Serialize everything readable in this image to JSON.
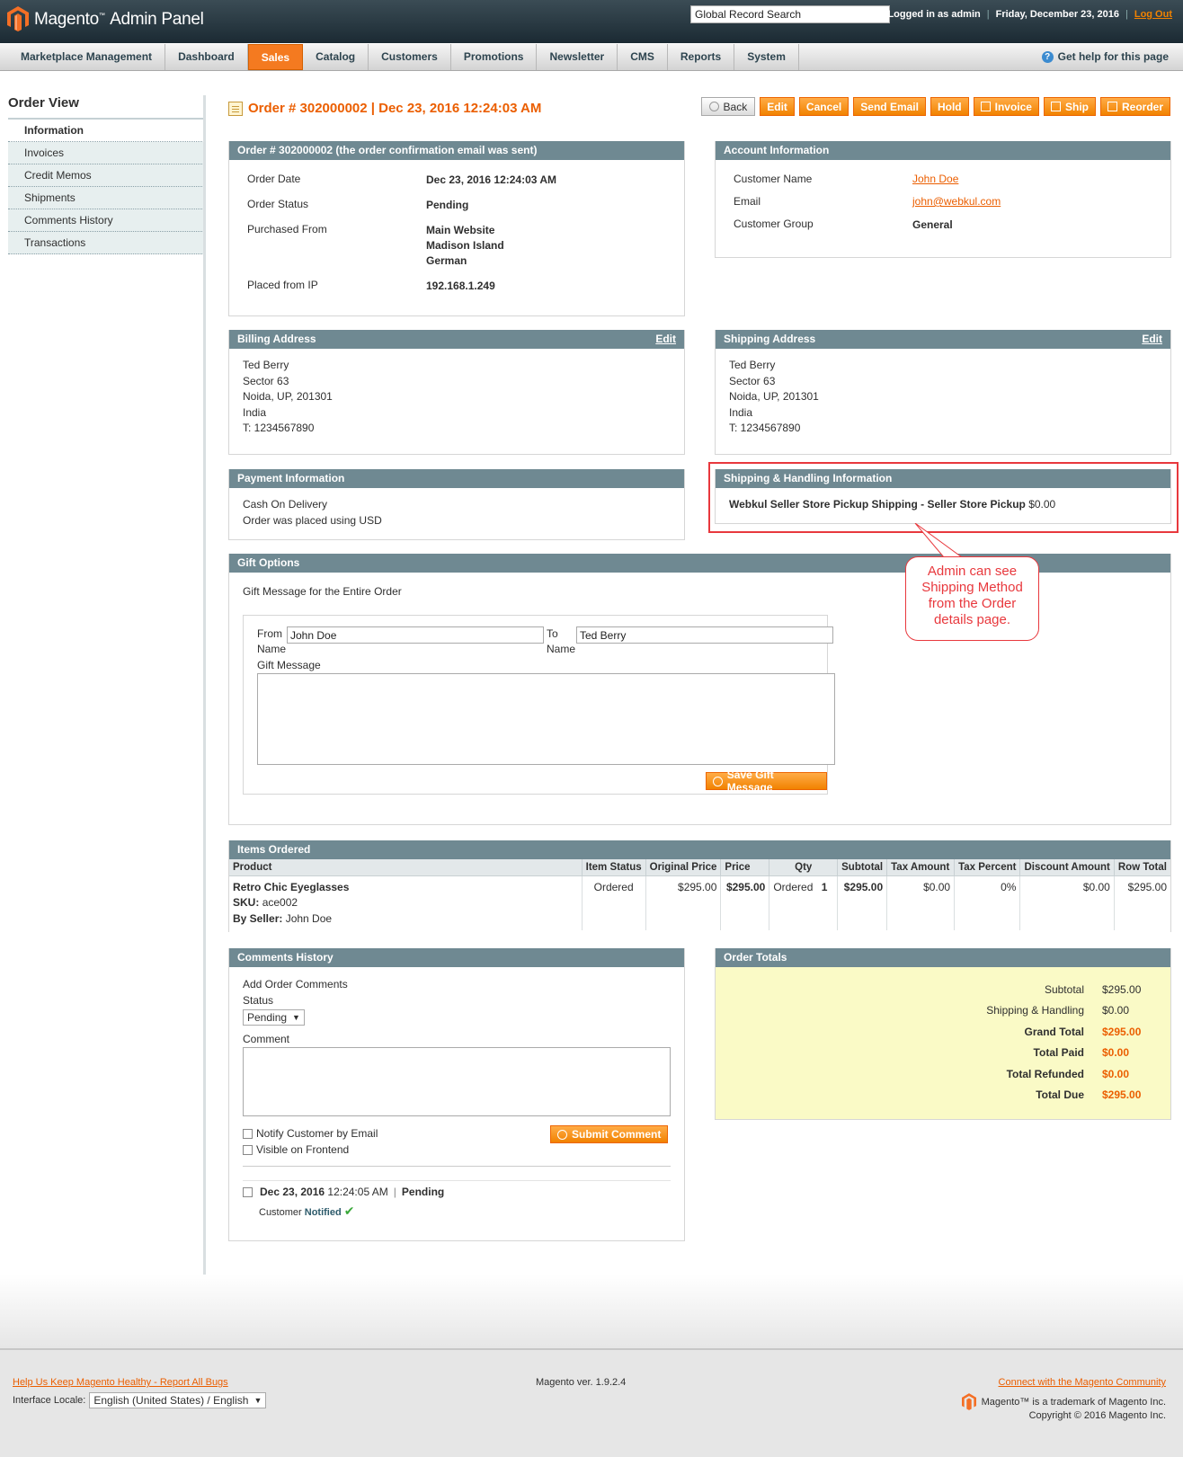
{
  "header": {
    "brand": "Magento",
    "brand_sub": "Admin Panel",
    "global_search": "Global Record Search",
    "logged_in": "Logged in as admin",
    "date": "Friday, December 23, 2016",
    "logout": "Log Out"
  },
  "nav": {
    "items": [
      "Marketplace Management",
      "Dashboard",
      "Sales",
      "Catalog",
      "Customers",
      "Promotions",
      "Newsletter",
      "CMS",
      "Reports",
      "System"
    ],
    "active": "Sales",
    "help": "Get help for this page"
  },
  "sidebar": {
    "title": "Order View",
    "items": [
      "Information",
      "Invoices",
      "Credit Memos",
      "Shipments",
      "Comments History",
      "Transactions"
    ]
  },
  "page": {
    "title": "Order # 302000002 | Dec 23, 2016 12:24:03 AM",
    "buttons": [
      "Back",
      "Edit",
      "Cancel",
      "Send Email",
      "Hold",
      "Invoice",
      "Ship",
      "Reorder"
    ]
  },
  "order": {
    "head": "Order # 302000002 (the order confirmation email was sent)",
    "date_label": "Order Date",
    "date": "Dec 23, 2016 12:24:03 AM",
    "status_label": "Order Status",
    "status": "Pending",
    "from_label": "Purchased From",
    "from_1": "Main Website",
    "from_2": "Madison Island",
    "from_3": "German",
    "ip_label": "Placed from IP",
    "ip": "192.168.1.249"
  },
  "account": {
    "head": "Account Information",
    "name_label": "Customer Name",
    "name": "John Doe",
    "email_label": "Email",
    "email": "john@webkul.com",
    "group_label": "Customer Group",
    "group": "General"
  },
  "billing": {
    "head": "Billing Address",
    "edit": "Edit",
    "lines": [
      "Ted Berry",
      "Sector 63",
      "Noida, UP, 201301",
      "India",
      "T: 1234567890"
    ]
  },
  "shipping": {
    "head": "Shipping Address",
    "edit": "Edit",
    "lines": [
      "Ted Berry",
      "Sector 63",
      "Noida, UP, 201301",
      "India",
      "T: 1234567890"
    ]
  },
  "payment": {
    "head": "Payment Information",
    "method": "Cash On Delivery",
    "currency": "Order was placed using USD"
  },
  "handling": {
    "head": "Shipping & Handling Information",
    "method": "Webkul Seller Store Pickup Shipping - Seller Store Pickup",
    "price": "$0.00"
  },
  "callout": {
    "lines": [
      "Admin can see",
      "Shipping Method",
      "from the Order",
      "details page."
    ]
  },
  "gift": {
    "head": "Gift Options",
    "subtitle": "Gift Message for the Entire Order",
    "from_label_1": "From",
    "from_label_2": "Name",
    "from_value": "John Doe",
    "to_label_1": "To",
    "to_label_2": "Name",
    "to_value": "Ted Berry",
    "message_label": "Gift Message",
    "save": "Save Gift Message"
  },
  "items": {
    "head": "Items Ordered",
    "columns": [
      "Product",
      "Item Status",
      "Original Price",
      "Price",
      "Qty",
      "Subtotal",
      "Tax Amount",
      "Tax Percent",
      "Discount Amount",
      "Row Total"
    ],
    "row": {
      "product": "Retro Chic Eyeglasses",
      "sku_label": "SKU:",
      "sku": "ace002",
      "seller_label": "By Seller:",
      "seller": "John Doe",
      "status": "Ordered",
      "original_price": "$295.00",
      "price": "$295.00",
      "qty_label": "Ordered",
      "qty": "1",
      "subtotal": "$295.00",
      "tax_amount": "$0.00",
      "tax_percent": "0%",
      "discount": "$0.00",
      "row_total": "$295.00"
    }
  },
  "comments": {
    "head": "Comments History",
    "add_label": "Add Order Comments",
    "status_label": "Status",
    "status_value": "Pending",
    "comment_label": "Comment",
    "notify": "Notify Customer by Email",
    "visible": "Visible on Frontend",
    "submit": "Submit Comment",
    "history_date": "Dec 23, 2016",
    "history_time": "12:24:05 AM",
    "history_status": "Pending",
    "history_customer": "Customer",
    "history_notified": "Notified"
  },
  "totals": {
    "head": "Order Totals",
    "subtotal_label": "Subtotal",
    "subtotal": "$295.00",
    "shipping_label": "Shipping & Handling",
    "shipping": "$0.00",
    "grand_label": "Grand Total",
    "grand": "$295.00",
    "paid_label": "Total Paid",
    "paid": "$0.00",
    "refunded_label": "Total Refunded",
    "refunded": "$0.00",
    "due_label": "Total Due",
    "due": "$295.00"
  },
  "footer": {
    "bugs": "Help Us Keep Magento Healthy - Report All Bugs",
    "locale_label": "Interface Locale:",
    "locale": "English (United States) / English",
    "version": "Magento ver. 1.9.2.4",
    "community": "Connect with the Magento Community",
    "trademark": "Magento™ is a trademark of Magento Inc.",
    "copyright": "Copyright © 2016 Magento Inc."
  }
}
